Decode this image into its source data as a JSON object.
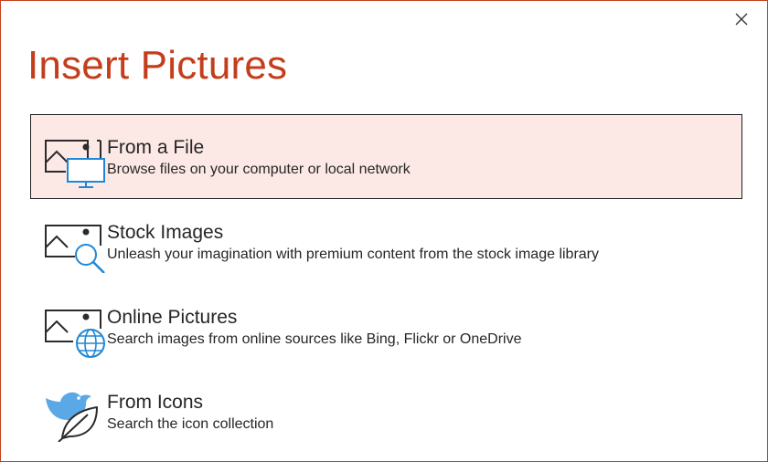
{
  "dialog": {
    "title": "Insert Pictures",
    "close_icon": "close-icon",
    "accent_color": "#c43e1c",
    "selected_bg": "#fce9e6"
  },
  "options": [
    {
      "title": "From a File",
      "description": "Browse files on your computer or local network",
      "icon": "picture-computer-icon",
      "selected": true
    },
    {
      "title": "Stock Images",
      "description": "Unleash your imagination with premium content from the stock image library",
      "icon": "picture-search-icon",
      "selected": false
    },
    {
      "title": "Online Pictures",
      "description": "Search images from online sources like Bing, Flickr or OneDrive",
      "icon": "picture-globe-icon",
      "selected": false
    },
    {
      "title": "From Icons",
      "description": "Search the icon collection",
      "icon": "icons-bird-leaf-icon",
      "selected": false
    }
  ]
}
